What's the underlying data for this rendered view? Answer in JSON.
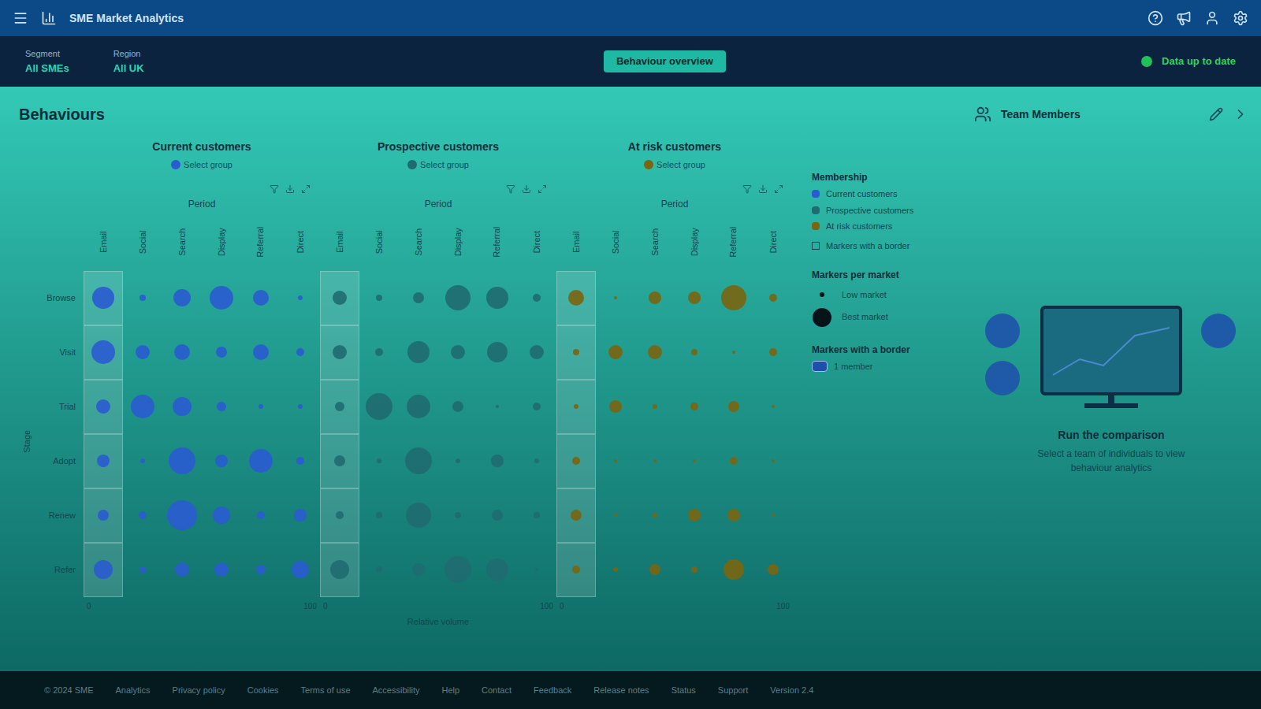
{
  "app": {
    "title": "SME Market Analytics"
  },
  "nav": {
    "filters": [
      {
        "label": "Segment",
        "value": "All SMEs"
      },
      {
        "label": "Region",
        "value": "All UK"
      }
    ],
    "center": "Behaviour overview",
    "status": "Data up to date"
  },
  "page": {
    "title": "Behaviours",
    "y_axis": "Stage",
    "x_axis": "Relative volume"
  },
  "row_labels": [
    "Browse",
    "Visit",
    "Trial",
    "Adopt",
    "Renew",
    "Refer"
  ],
  "groups": [
    {
      "title": "Current customers",
      "chip": "Select group",
      "period": "Period",
      "color": "#2a5bd0",
      "axis_min": "0",
      "axis_max": "100",
      "columns": [
        {
          "label": "Email",
          "selected": true
        },
        {
          "label": "Social",
          "selected": false
        },
        {
          "label": "Search",
          "selected": false
        },
        {
          "label": "Display",
          "selected": false
        },
        {
          "label": "Referral",
          "selected": false
        },
        {
          "label": "Direct",
          "selected": false
        }
      ],
      "values": [
        [
          28,
          8,
          22,
          30,
          20,
          6
        ],
        [
          30,
          18,
          20,
          14,
          20,
          10
        ],
        [
          18,
          30,
          24,
          12,
          6,
          6
        ],
        [
          16,
          6,
          34,
          16,
          30,
          10
        ],
        [
          14,
          10,
          38,
          22,
          10,
          16
        ],
        [
          24,
          8,
          18,
          18,
          12,
          22
        ]
      ]
    },
    {
      "title": "Prospective customers",
      "chip": "Select group",
      "period": "Period",
      "color": "#1f6b70",
      "axis_min": "0",
      "axis_max": "100",
      "columns": [
        {
          "label": "Email",
          "selected": true
        },
        {
          "label": "Social",
          "selected": false
        },
        {
          "label": "Search",
          "selected": false
        },
        {
          "label": "Display",
          "selected": false
        },
        {
          "label": "Referral",
          "selected": false
        },
        {
          "label": "Direct",
          "selected": false
        }
      ],
      "values": [
        [
          18,
          8,
          14,
          32,
          28,
          10
        ],
        [
          18,
          10,
          28,
          18,
          26,
          18
        ],
        [
          12,
          34,
          30,
          14,
          4,
          10
        ],
        [
          14,
          6,
          34,
          6,
          16,
          6
        ],
        [
          10,
          8,
          32,
          8,
          14,
          8
        ],
        [
          24,
          8,
          16,
          34,
          28,
          4
        ]
      ]
    },
    {
      "title": "At risk customers",
      "chip": "Select group",
      "period": "Period",
      "color": "#7a6510",
      "axis_min": "0",
      "axis_max": "100",
      "columns": [
        {
          "label": "Email",
          "selected": true
        },
        {
          "label": "Social",
          "selected": false
        },
        {
          "label": "Search",
          "selected": false
        },
        {
          "label": "Display",
          "selected": false
        },
        {
          "label": "Referral",
          "selected": false
        },
        {
          "label": "Direct",
          "selected": false
        }
      ],
      "values": [
        [
          20,
          4,
          16,
          16,
          32,
          10
        ],
        [
          8,
          18,
          18,
          8,
          4,
          10
        ],
        [
          6,
          16,
          6,
          10,
          14,
          4
        ],
        [
          10,
          4,
          4,
          4,
          10,
          4
        ],
        [
          14,
          4,
          6,
          16,
          16,
          4
        ],
        [
          10,
          6,
          14,
          8,
          26,
          14
        ]
      ]
    }
  ],
  "legend": {
    "membership_title": "Membership",
    "membership": [
      {
        "label": "Current customers",
        "color": "#2a5bd0"
      },
      {
        "label": "Prospective customers",
        "color": "#1f6b70"
      },
      {
        "label": "At risk customers",
        "color": "#7a6510"
      }
    ],
    "border_option": {
      "label": "Markers with a border",
      "checked": false
    },
    "market_title": "Markers per market",
    "market": [
      {
        "label": "Low market",
        "size": 6
      },
      {
        "label": "Best market",
        "size": 24
      }
    ],
    "border_title": "Markers with a border",
    "border_item": "1 member"
  },
  "panel": {
    "title": "Team Members",
    "empty_title": "Run the comparison",
    "empty_text": "Select a team of individuals to view behaviour analytics"
  },
  "footer": [
    "© 2024 SME",
    "Analytics",
    "Privacy policy",
    "Cookies",
    "Terms of use",
    "Accessibility",
    "Help",
    "Contact",
    "Feedback",
    "Release notes",
    "Status",
    "Support",
    "Version 2.4"
  ]
}
